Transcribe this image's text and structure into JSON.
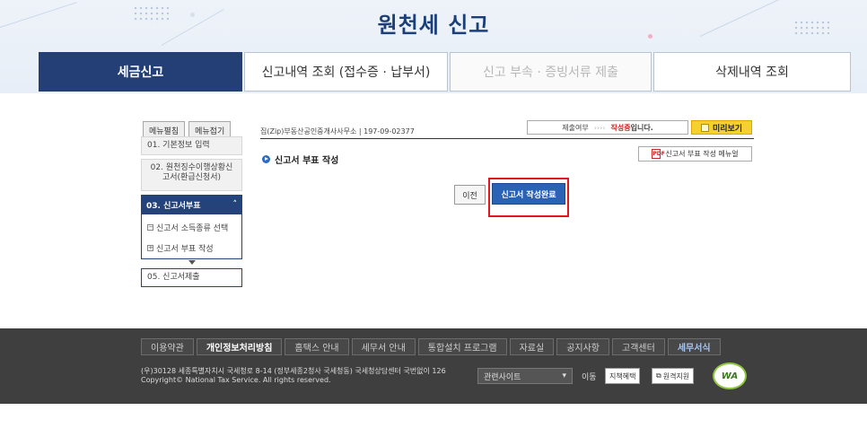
{
  "header": {
    "title": "원천세 신고"
  },
  "tabs": [
    {
      "label": "세금신고",
      "state": "active"
    },
    {
      "label": "신고내역 조회 (접수증 · 납부서)",
      "state": "normal"
    },
    {
      "label": "신고 부속 · 증빙서류 제출",
      "state": "disabled"
    },
    {
      "label": "삭제내역 조회",
      "state": "normal"
    }
  ],
  "sidebar": {
    "expand_label": "메뉴펼침",
    "collapse_label": "메뉴접기",
    "items": [
      {
        "label": "01. 기본정보 입력"
      },
      {
        "label": "02. 원천징수이행상황신고서(환급신청서)"
      },
      {
        "label": "03. 신고서부표"
      },
      {
        "label": "05. 신고서제출"
      }
    ],
    "sub_items": [
      {
        "label": "신고서 소득종류 선택",
        "mark": "−"
      },
      {
        "label": "신고서 부표 작성",
        "mark": "+"
      }
    ]
  },
  "content": {
    "company_info": "집(Zip)부동산공인중개사사무소 | 197-09-02377",
    "status_label": "제출여부",
    "status_arrows": "››››",
    "status_value": "작성중",
    "status_suffix": "입니다.",
    "preview_label": "미리보기",
    "section_title": "신고서 부표 작성",
    "manual_label": "신고서 부표 작성 메뉴얼",
    "pdf_icon_text": "PDF",
    "prev_label": "이전",
    "complete_label": "신고서 작성완료"
  },
  "footer": {
    "links": [
      {
        "label": "이용약관",
        "style": "normal"
      },
      {
        "label": "개인정보처리방침",
        "style": "bold"
      },
      {
        "label": "홈택스 안내",
        "style": "normal"
      },
      {
        "label": "세무서 안내",
        "style": "normal"
      },
      {
        "label": "통합설치 프로그램",
        "style": "normal"
      },
      {
        "label": "자료실",
        "style": "normal"
      },
      {
        "label": "공지사항",
        "style": "normal"
      },
      {
        "label": "고객센터",
        "style": "normal"
      },
      {
        "label": "세무서식",
        "style": "bold2"
      }
    ],
    "address": "(우)30128 세종특별자치시 국세청로 8-14 (정부세종2청사 국세청동) 국세청상담센터 국번없이 126",
    "copyright": "Copyright© National Tax Service. All rights reserved.",
    "related_sites_label": "관련사이트",
    "go_label": "이동",
    "badge1": "지책혜택",
    "badge2": "원격지원",
    "wa_label": "WA"
  },
  "colors": {
    "brand_navy": "#233f75",
    "accent_blue": "#2a63b6",
    "highlight_red": "#e1191e",
    "preview_yellow": "#f6d02f"
  }
}
